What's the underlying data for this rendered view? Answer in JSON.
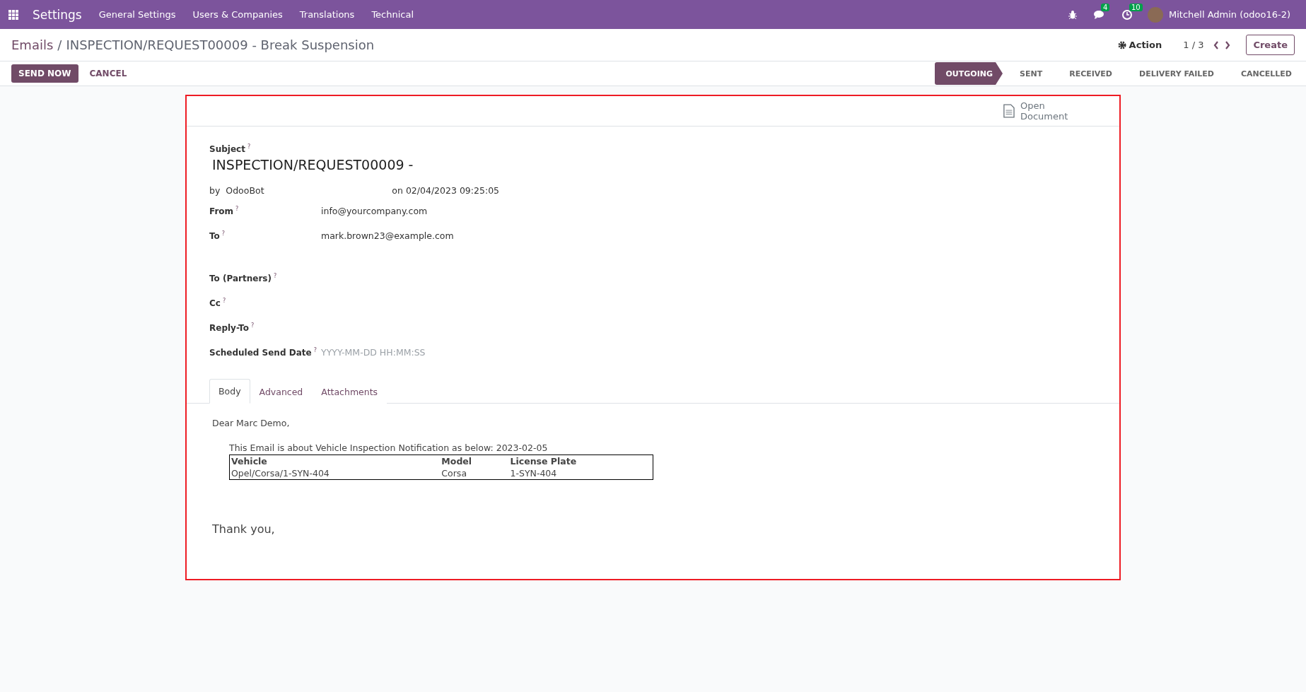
{
  "navbar": {
    "app": "Settings",
    "menus": [
      "General Settings",
      "Users & Companies",
      "Translations",
      "Technical"
    ],
    "messages_count": "4",
    "activities_count": "10",
    "user": "Mitchell Admin (odoo16-2)"
  },
  "breadcrumb": {
    "parent": "Emails",
    "separator": "/",
    "current": "INSPECTION/REQUEST00009 - Break Suspension"
  },
  "control": {
    "action": "Action",
    "pager": "1 / 3",
    "create": "Create"
  },
  "buttons": [
    {
      "label": "SEND NOW",
      "kind": "primary"
    },
    {
      "label": "CANCEL",
      "kind": "link"
    }
  ],
  "statuses": [
    {
      "label": "OUTGOING",
      "selected": true
    },
    {
      "label": "SENT",
      "selected": false
    },
    {
      "label": "RECEIVED",
      "selected": false
    },
    {
      "label": "DELIVERY FAILED",
      "selected": false
    },
    {
      "label": "CANCELLED",
      "selected": false
    }
  ],
  "smart_button": {
    "label": "Open Document"
  },
  "subject": {
    "label": "Subject",
    "tip": "?",
    "value": "INSPECTION/REQUEST00009 -"
  },
  "author": {
    "by": "by",
    "name": "OdooBot",
    "date": "on 02/04/2023 09:25:05"
  },
  "fields": [
    {
      "label": "From",
      "tip": "?",
      "value": "info@yourcompany.com"
    },
    {
      "label": "To",
      "tip": "?",
      "value": "mark.brown23@example.com"
    },
    {
      "label": "To (Partners)",
      "tip": "?",
      "gap": true
    },
    {
      "label": "Cc",
      "tip": "?"
    },
    {
      "label": "Reply-To",
      "tip": "?"
    },
    {
      "label": "Scheduled Send Date",
      "tip": "?",
      "placeholder": "YYYY-MM-DD HH:MM:SS"
    }
  ],
  "tabs": [
    {
      "label": "Body",
      "selected": true
    },
    {
      "label": "Advanced",
      "selected": false
    },
    {
      "label": "Attachments",
      "selected": false
    }
  ],
  "body": {
    "greeting": "Dear Marc Demo,",
    "intro": "This Email is about Vehicle Inspection Notification as below: 2023-02-05",
    "table": {
      "columns": [
        "Vehicle",
        "Model",
        "License Plate"
      ],
      "rows": [
        [
          "Opel/Corsa/1-SYN-404",
          "Corsa",
          "1-SYN-404"
        ]
      ]
    },
    "closing": "Thank you,"
  }
}
